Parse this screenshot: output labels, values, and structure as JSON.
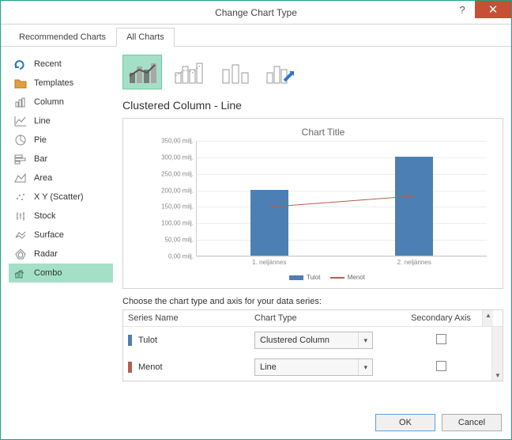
{
  "window": {
    "title": "Change Chart Type"
  },
  "tabs": {
    "recommended": "Recommended Charts",
    "all": "All Charts"
  },
  "sidebar": {
    "items": [
      {
        "label": "Recent"
      },
      {
        "label": "Templates"
      },
      {
        "label": "Column"
      },
      {
        "label": "Line"
      },
      {
        "label": "Pie"
      },
      {
        "label": "Bar"
      },
      {
        "label": "Area"
      },
      {
        "label": "X Y (Scatter)"
      },
      {
        "label": "Stock"
      },
      {
        "label": "Surface"
      },
      {
        "label": "Radar"
      },
      {
        "label": "Combo"
      }
    ]
  },
  "subtype_title": "Clustered Column - Line",
  "chart_data": {
    "type": "combo",
    "title": "Chart Title",
    "categories": [
      "1. neljännes",
      "2. neljännes"
    ],
    "ylim": [
      0,
      350
    ],
    "ystep": 50,
    "yunit": "milj.",
    "series": [
      {
        "name": "Tulot",
        "type": "bar",
        "color": "#4c7fb3",
        "values": [
          200,
          300
        ]
      },
      {
        "name": "Menot",
        "type": "line",
        "color": "#b85c4d",
        "values": [
          150,
          183
        ]
      }
    ]
  },
  "series_section": {
    "header": "Choose the chart type and axis for your data series:",
    "col_name": "Series Name",
    "col_type": "Chart Type",
    "col_axis": "Secondary Axis",
    "rows": [
      {
        "name": "Tulot",
        "type": "Clustered Column",
        "secondary": false,
        "color": "blue"
      },
      {
        "name": "Menot",
        "type": "Line",
        "secondary": false,
        "color": "red"
      }
    ]
  },
  "buttons": {
    "ok": "OK",
    "cancel": "Cancel"
  }
}
